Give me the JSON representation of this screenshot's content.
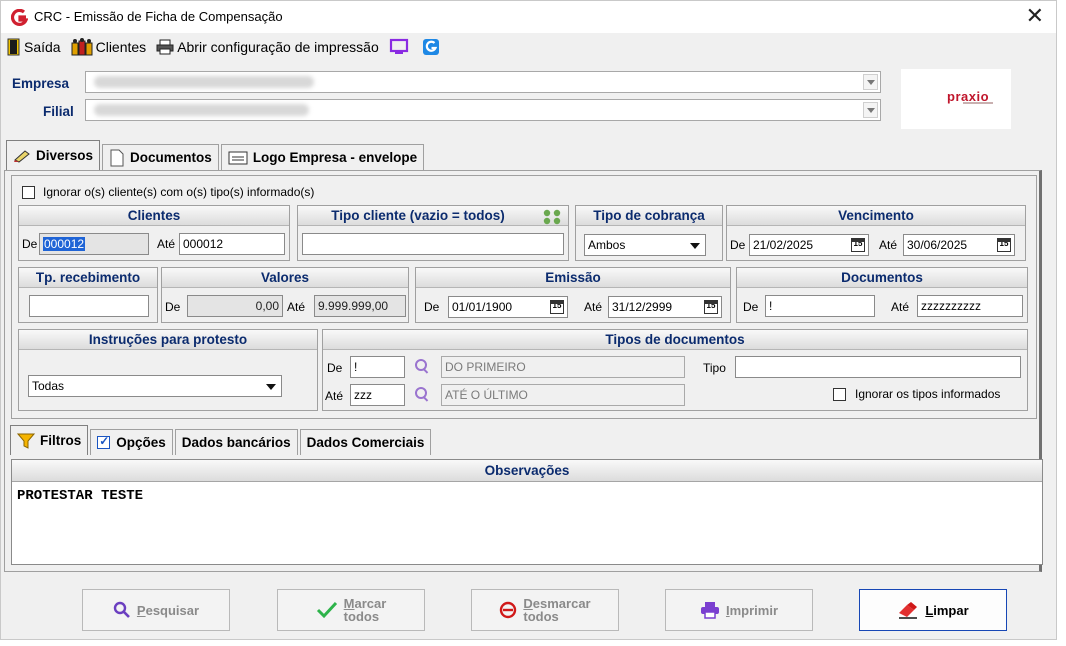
{
  "window": {
    "title": "CRC - Emissão de Ficha de Compensação"
  },
  "toolbar": {
    "exit": "Saída",
    "clients": "Clientes",
    "print_config": "Abrir configuração de impressão"
  },
  "header": {
    "empresa_label": "Empresa",
    "filial_label": "Filial",
    "logo_text": "praxio"
  },
  "top_tabs": [
    "Diversos",
    "Documentos",
    "Logo Empresa - envelope"
  ],
  "filters": {
    "ignore_clients_label": "Ignorar o(s) cliente(s) com o(s) tipo(s) informado(s)",
    "clientes": {
      "title": "Clientes",
      "de_label": "De",
      "de_value": "000012",
      "ate_label": "Até",
      "ate_value": "000012"
    },
    "tipo_cliente": {
      "title": "Tipo cliente (vazio = todos)",
      "value": ""
    },
    "tipo_cobranca": {
      "title": "Tipo de cobrança",
      "value": "Ambos"
    },
    "vencimento": {
      "title": "Vencimento",
      "de_label": "De",
      "de_value": "21/02/2025",
      "ate_label": "Até",
      "ate_value": "30/06/2025"
    },
    "tp_recebimento": {
      "title": "Tp. recebimento",
      "value": ""
    },
    "valores": {
      "title": "Valores",
      "de_label": "De",
      "de_value": "0,00",
      "ate_label": "Até",
      "ate_value": "9.999.999,00"
    },
    "emissao": {
      "title": "Emissão",
      "de_label": "De",
      "de_value": "01/01/1900",
      "ate_label": "Até",
      "ate_value": "31/12/2999"
    },
    "documentos": {
      "title": "Documentos",
      "de_label": "De",
      "de_value": "!",
      "ate_label": "Até",
      "ate_value": "zzzzzzzzzz"
    },
    "instrucoes": {
      "title": "Instruções para protesto",
      "value": "Todas"
    },
    "tipos_documentos": {
      "title": "Tipos de documentos",
      "de_label": "De",
      "de_value": "!",
      "de_desc": "DO PRIMEIRO",
      "ate_label": "Até",
      "ate_value": "zzz",
      "ate_desc": "ATÉ O ÚLTIMO",
      "tipo_label": "Tipo",
      "tipo_value": "",
      "ignore_label": "Ignorar os tipos informados"
    },
    "calendar_glyph": "15"
  },
  "bottom_tabs": [
    "Filtros",
    "Opções",
    "Dados bancários",
    "Dados Comerciais"
  ],
  "observacoes": {
    "title": "Observações",
    "text": "PROTESTAR TESTE"
  },
  "buttons": {
    "pesquisar": {
      "first": "P",
      "rest": "esquisar"
    },
    "marcar": {
      "first": "M",
      "rest": "arcar",
      "line2": "todos"
    },
    "desmarcar": {
      "first": "D",
      "rest": "esmarcar",
      "line2": "todos"
    },
    "imprimir": {
      "first": "I",
      "rest": "mprimir"
    },
    "limpar": {
      "first": "L",
      "rest": "impar"
    }
  }
}
